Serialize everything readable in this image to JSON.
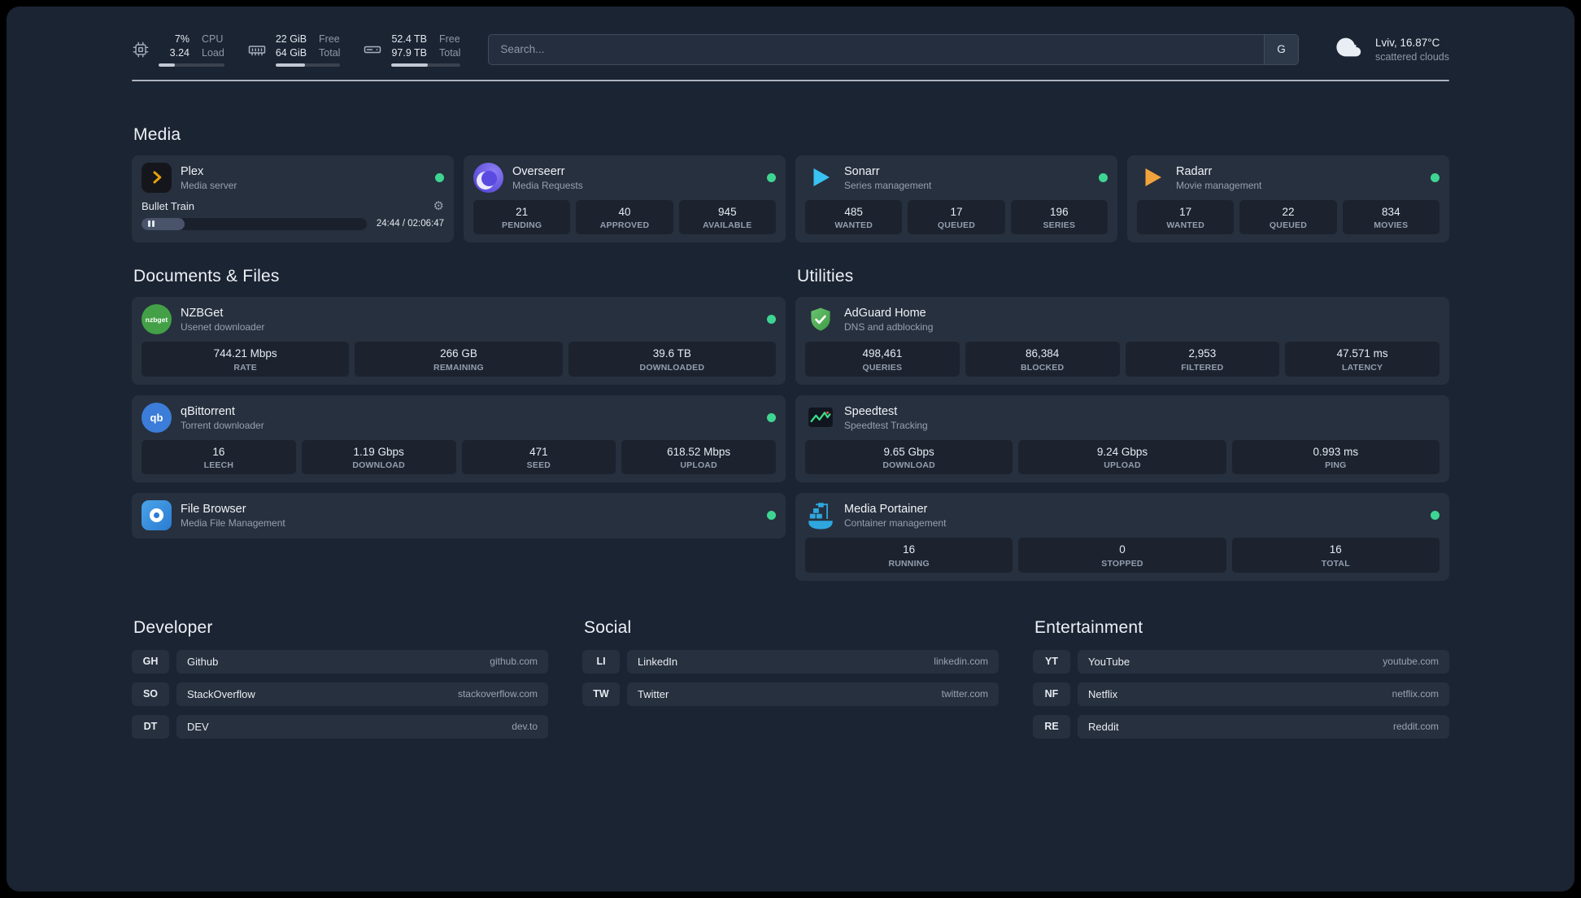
{
  "topbar": {
    "cpu": {
      "value1": "7%",
      "value2": "3.24",
      "label1": "CPU",
      "label2": "Load",
      "progress_pct": 25
    },
    "memory": {
      "value1": "22 GiB",
      "value2": "64 GiB",
      "label1": "Free",
      "label2": "Total",
      "progress_pct": 45
    },
    "disk": {
      "value1": "52.4 TB",
      "value2": "97.9 TB",
      "label1": "Free",
      "label2": "Total",
      "progress_pct": 52
    },
    "search": {
      "placeholder": "Search...",
      "provider": "G"
    },
    "weather": {
      "location": "Lviv, 16.87°C",
      "condition": "scattered clouds"
    }
  },
  "media": {
    "title": "Media",
    "plex": {
      "name": "Plex",
      "desc": "Media server",
      "status": "online",
      "now_playing": {
        "title": "Bullet Train",
        "time": "24:44 / 02:06:47",
        "progress_pct": 19
      }
    },
    "overseerr": {
      "name": "Overseerr",
      "desc": "Media Requests",
      "status": "online",
      "stats": [
        {
          "value": "21",
          "label": "PENDING"
        },
        {
          "value": "40",
          "label": "APPROVED"
        },
        {
          "value": "945",
          "label": "AVAILABLE"
        }
      ]
    },
    "sonarr": {
      "name": "Sonarr",
      "desc": "Series management",
      "status": "online",
      "stats": [
        {
          "value": "485",
          "label": "WANTED"
        },
        {
          "value": "17",
          "label": "QUEUED"
        },
        {
          "value": "196",
          "label": "SERIES"
        }
      ]
    },
    "radarr": {
      "name": "Radarr",
      "desc": "Movie management",
      "status": "online",
      "stats": [
        {
          "value": "17",
          "label": "WANTED"
        },
        {
          "value": "22",
          "label": "QUEUED"
        },
        {
          "value": "834",
          "label": "MOVIES"
        }
      ]
    }
  },
  "documents": {
    "title": "Documents & Files",
    "nzbget": {
      "name": "NZBGet",
      "desc": "Usenet downloader",
      "status": "online",
      "stats": [
        {
          "value": "744.21 Mbps",
          "label": "RATE"
        },
        {
          "value": "266 GB",
          "label": "REMAINING"
        },
        {
          "value": "39.6 TB",
          "label": "DOWNLOADED"
        }
      ]
    },
    "qbittorrent": {
      "name": "qBittorrent",
      "desc": "Torrent downloader",
      "status": "online",
      "stats": [
        {
          "value": "16",
          "label": "LEECH"
        },
        {
          "value": "1.19 Gbps",
          "label": "DOWNLOAD"
        },
        {
          "value": "471",
          "label": "SEED"
        },
        {
          "value": "618.52 Mbps",
          "label": "UPLOAD"
        }
      ]
    },
    "filebrowser": {
      "name": "File Browser",
      "desc": "Media File Management",
      "status": "online"
    }
  },
  "utilities": {
    "title": "Utilities",
    "adguard": {
      "name": "AdGuard Home",
      "desc": "DNS and adblocking",
      "stats": [
        {
          "value": "498,461",
          "label": "QUERIES"
        },
        {
          "value": "86,384",
          "label": "BLOCKED"
        },
        {
          "value": "2,953",
          "label": "FILTERED"
        },
        {
          "value": "47.571 ms",
          "label": "LATENCY"
        }
      ]
    },
    "speedtest": {
      "name": "Speedtest",
      "desc": "Speedtest Tracking",
      "stats": [
        {
          "value": "9.65 Gbps",
          "label": "DOWNLOAD"
        },
        {
          "value": "9.24 Gbps",
          "label": "UPLOAD"
        },
        {
          "value": "0.993 ms",
          "label": "PING"
        }
      ]
    },
    "portainer": {
      "name": "Media Portainer",
      "desc": "Container management",
      "status": "online",
      "stats": [
        {
          "value": "16",
          "label": "RUNNING"
        },
        {
          "value": "0",
          "label": "STOPPED"
        },
        {
          "value": "16",
          "label": "TOTAL"
        }
      ]
    }
  },
  "bookmarks": {
    "developer": {
      "title": "Developer",
      "items": [
        {
          "abbr": "GH",
          "name": "Github",
          "url": "github.com"
        },
        {
          "abbr": "SO",
          "name": "StackOverflow",
          "url": "stackoverflow.com"
        },
        {
          "abbr": "DT",
          "name": "DEV",
          "url": "dev.to"
        }
      ]
    },
    "social": {
      "title": "Social",
      "items": [
        {
          "abbr": "LI",
          "name": "LinkedIn",
          "url": "linkedin.com"
        },
        {
          "abbr": "TW",
          "name": "Twitter",
          "url": "twitter.com"
        }
      ]
    },
    "entertainment": {
      "title": "Entertainment",
      "items": [
        {
          "abbr": "YT",
          "name": "YouTube",
          "url": "youtube.com"
        },
        {
          "abbr": "NF",
          "name": "Netflix",
          "url": "netflix.com"
        },
        {
          "abbr": "RE",
          "name": "Reddit",
          "url": "reddit.com"
        }
      ]
    }
  },
  "icons": {
    "gear": "⚙",
    "nzbget_text": "nzbget",
    "qbittorrent_text": "qb"
  },
  "colors": {
    "status_online": "#3ed592",
    "accent_plex": "#e5a00d",
    "accent_sonarr": "#39c3f2",
    "accent_radarr": "#f2a33c",
    "accent_adguard": "#4caf50",
    "accent_portainer": "#2ea7df"
  }
}
